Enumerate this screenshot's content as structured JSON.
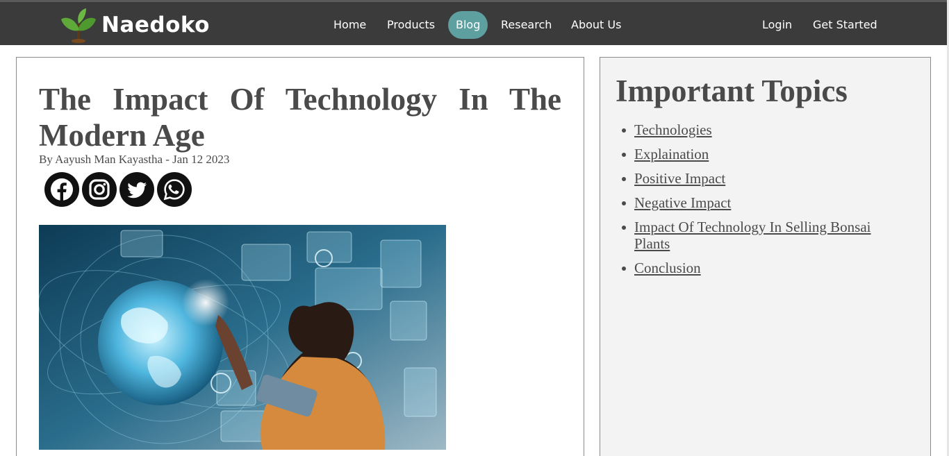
{
  "brand": {
    "name": "Naedoko",
    "logo_icon": "bonsai-sprout-icon",
    "leaf_color": "#5fa83a"
  },
  "nav": {
    "links": [
      {
        "label": "Home"
      },
      {
        "label": "Products"
      },
      {
        "label": "Blog",
        "active": true
      },
      {
        "label": "Research"
      },
      {
        "label": "About Us"
      }
    ],
    "login_label": "Login",
    "get_started_label": "Get Started",
    "active_color": "#5e9fa0",
    "bar_color": "#3b3b3b"
  },
  "article": {
    "title": "The Impact Of Technology In The Modern Age",
    "byline": "By Aayush Man Kayastha - Jan 12 2023",
    "social_icons": [
      "facebook-icon",
      "instagram-icon",
      "twitter-icon",
      "whatsapp-icon"
    ],
    "hero_image": "woman-touching-holographic-globe-interface"
  },
  "sidebar": {
    "title": "Important Topics",
    "topics": [
      "Technologies",
      "Explaination",
      "Positive Impact",
      "Negative Impact",
      "Impact Of Technology In Selling Bonsai Plants",
      "Conclusion"
    ]
  }
}
